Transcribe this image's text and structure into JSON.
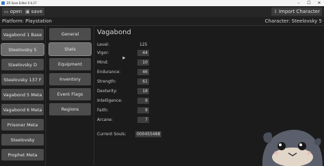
{
  "window": {
    "title": "ER Save Editor 0.0.27"
  },
  "toolbar": {
    "open_label": "open",
    "save_label": "save",
    "import_label": "Import Character"
  },
  "info": {
    "platform": "Platform: Playstation",
    "character": "Character: Steelovsky 5"
  },
  "characters": [
    {
      "label": "Vagabond 1 Base",
      "active": false
    },
    {
      "label": "Steelovsky 5",
      "active": true
    },
    {
      "label": "Steelovsky D",
      "active": false
    },
    {
      "label": "Steelovsky 137 F",
      "active": false
    },
    {
      "label": "Vagabond 5 Meta",
      "active": false
    },
    {
      "label": "Vagabond 6 Meta",
      "active": false
    },
    {
      "label": "Prisoner Meta",
      "active": false
    },
    {
      "label": "Steelovsky",
      "active": false
    },
    {
      "label": "Prophet Meta",
      "active": false
    }
  ],
  "nav": [
    {
      "label": "General",
      "active": false
    },
    {
      "label": "Stats",
      "active": true
    },
    {
      "label": "Equipment",
      "active": false
    },
    {
      "label": "Inventory",
      "active": false
    },
    {
      "label": "Event Flags",
      "active": false
    },
    {
      "label": "Regions",
      "active": false
    }
  ],
  "stats": {
    "class_name": "Vagabond",
    "level_label": "Level:",
    "level_value": "125",
    "items": [
      {
        "label": "Vigor:",
        "value": "44"
      },
      {
        "label": "Mind:",
        "value": "10"
      },
      {
        "label": "Endurance:",
        "value": "46"
      },
      {
        "label": "Strength:",
        "value": "61"
      },
      {
        "label": "Dexterity:",
        "value": "18"
      },
      {
        "label": "Intelligence:",
        "value": "9"
      },
      {
        "label": "Faith:",
        "value": "9"
      },
      {
        "label": "Arcane:",
        "value": "7"
      }
    ],
    "souls_label": "Current Souls:",
    "souls_value": "000455488"
  }
}
